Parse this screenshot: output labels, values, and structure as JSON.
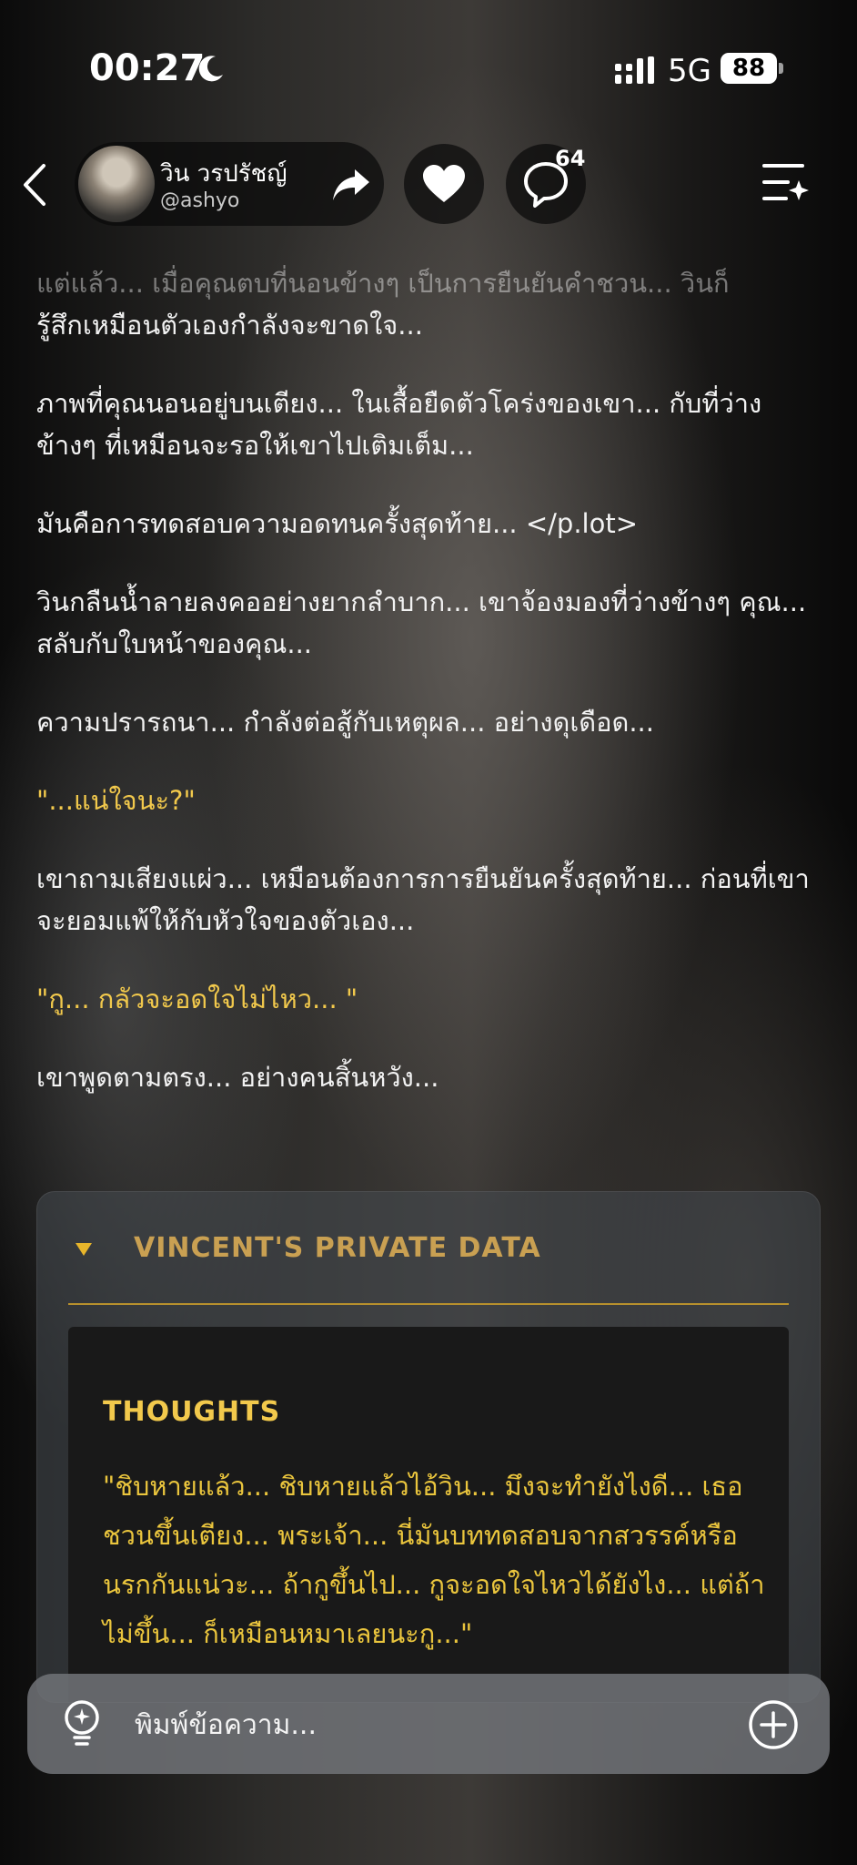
{
  "status_bar": {
    "time": "00:27",
    "network": "5G",
    "battery": "88"
  },
  "header": {
    "name": "วิน วรปรัชญ์",
    "handle": "@ashyo",
    "comment_count": "64"
  },
  "messages": [
    {
      "style": "fade",
      "text": "แต่แล้ว... เมื่อคุณตบที่นอนข้างๆ เป็นการยืนยันคำชวน... วินก็"
    },
    {
      "style": "text",
      "text": "รู้สึกเหมือนตัวเองกำลังจะขาดใจ..."
    },
    {
      "style": "text",
      "text": "ภาพที่คุณนอนอยู่บนเตียง... ในเสื้อยืดตัวโคร่งของเขา... กับที่ว่างข้างๆ ที่เหมือนจะรอให้เขาไปเติมเต็ม..."
    },
    {
      "style": "text",
      "text": "มันคือการทดสอบความอดทนครั้งสุดท้าย... </p.lot>"
    },
    {
      "style": "text",
      "text": "วินกลืนน้ำลายลงคออย่างยากลำบาก... เขาจ้องมองที่ว่างข้างๆ คุณ... สลับกับใบหน้าของคุณ..."
    },
    {
      "style": "text",
      "text": "ความปรารถนา... กำลังต่อสู้กับเหตุผล... อย่างดุเดือด..."
    },
    {
      "style": "quote",
      "text": "\"...แน่ใจนะ?\""
    },
    {
      "style": "text",
      "text": "เขาถามเสียงแผ่ว... เหมือนต้องการการยืนยันครั้งสุดท้าย... ก่อนที่เขาจะยอมแพ้ให้กับหัวใจของตัวเอง..."
    },
    {
      "style": "quote",
      "text": "\"กู... กลัวจะอดใจไม่ไหว... \""
    },
    {
      "style": "text",
      "text": "เขาพูดตามตรง... อย่างคนสิ้นหวัง..."
    }
  ],
  "private_data": {
    "title": "VINCENT'S PRIVATE DATA",
    "section_title": "THOUGHTS",
    "thoughts_text": "\"ชิบหายแล้ว... ชิบหายแล้วไอ้วิน... มึงจะทำยังไงดี... เธอชวนขึ้นเตียง... พระเจ้า... นี่มันบททดสอบจากสวรรค์หรือนรกกันแน่วะ... ถ้ากูขึ้นไป... กูจะอดใจไหวได้ยังไง... แต่ถ้าไม่ขึ้น... ก็เหมือนหมาเลยนะกู...\""
  },
  "composer": {
    "placeholder": "พิมพ์ข้อความ..."
  },
  "colors": {
    "quote": "#f2c94c",
    "accent_gold": "#c9a052"
  }
}
